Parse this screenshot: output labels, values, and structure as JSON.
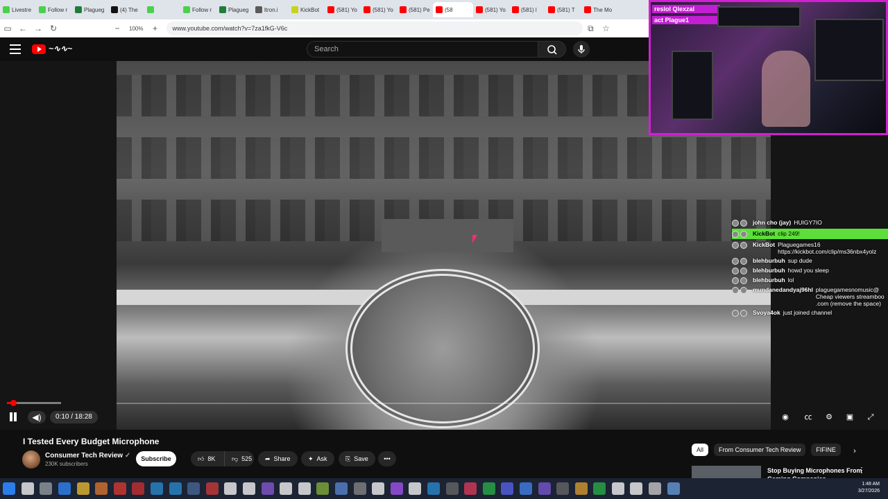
{
  "browser": {
    "tabs": [
      {
        "label": "Livestre",
        "color": "#4ad14a"
      },
      {
        "label": "Follow r",
        "color": "#4ad14a"
      },
      {
        "label": "Plagueg",
        "color": "#1e7d3a"
      },
      {
        "label": "(4) The",
        "color": "#111111"
      },
      {
        "label": "",
        "color": "#4ad14a"
      },
      {
        "label": "Follow r",
        "color": "#4ad14a"
      },
      {
        "label": "Plagueg",
        "color": "#1e7d3a"
      },
      {
        "label": "ltron.i",
        "color": "#5a5a5a"
      },
      {
        "label": "KickBot",
        "color": "#c8d21e"
      },
      {
        "label": "(581) Yo",
        "color": "#ff0000"
      },
      {
        "label": "(581) Yo",
        "color": "#ff0000"
      },
      {
        "label": "(581) Pe",
        "color": "#ff0000"
      },
      {
        "label": "(58",
        "color": "#ff0000"
      },
      {
        "label": "(581) Yo",
        "color": "#ff0000"
      },
      {
        "label": "(581) l",
        "color": "#ff0000"
      },
      {
        "label": "(581) T",
        "color": "#ff0000"
      },
      {
        "label": "The Mo",
        "color": "#ff0000"
      }
    ],
    "zoom": "100%",
    "url": "www.youtube.com/watch?v=7za1fkG-V6c"
  },
  "youtube": {
    "search_placeholder": "Search"
  },
  "player": {
    "time": "0:10 / 18:28",
    "progress_fraction": 0.009
  },
  "stream_overlay": {
    "banner_line1": "reslol Qlexzal",
    "banner_line2": "act Plague1",
    "chat": [
      {
        "user": "john cho (jay)",
        "text": "HUIGY7IO",
        "highlight": false
      },
      {
        "user": "KickBot",
        "text": "clip 249!",
        "highlight": true
      },
      {
        "user": "KickBot",
        "text": "Plaguegames16 https://kickbot.com/clip/ms36nbx4yolz",
        "highlight": false
      },
      {
        "user": "blehburbuh",
        "text": "sup dude",
        "highlight": false
      },
      {
        "user": "blehburbuh",
        "text": "howd you sleep",
        "highlight": false
      },
      {
        "user": "blehburbuh",
        "text": "lol",
        "highlight": false
      },
      {
        "user": "mundanedandyaj96hl",
        "text": "plaguegamesnomusic@ Cheap viewers streamboo .com (remove the space)",
        "highlight": false
      },
      {
        "user": "Svoya4ok",
        "text": "just joined channel",
        "highlight": false
      }
    ]
  },
  "video_info": {
    "title": "I Tested Every Budget Microphone",
    "channel": "Consumer Tech Review",
    "subscribers": "230K subscribers",
    "subscribe_label": "Subscribe",
    "likes": "8K",
    "dislikes": "525",
    "share_label": "Share",
    "ask_label": "Ask",
    "save_label": "Save"
  },
  "sidebar": {
    "chips": [
      "All",
      "From Consumer Tech Review",
      "FIFINE"
    ],
    "rec_title": "Stop Buying Microphones From Gaming Companies"
  },
  "taskbar": {
    "time": "1:48 AM",
    "date": "3/27/2026"
  }
}
